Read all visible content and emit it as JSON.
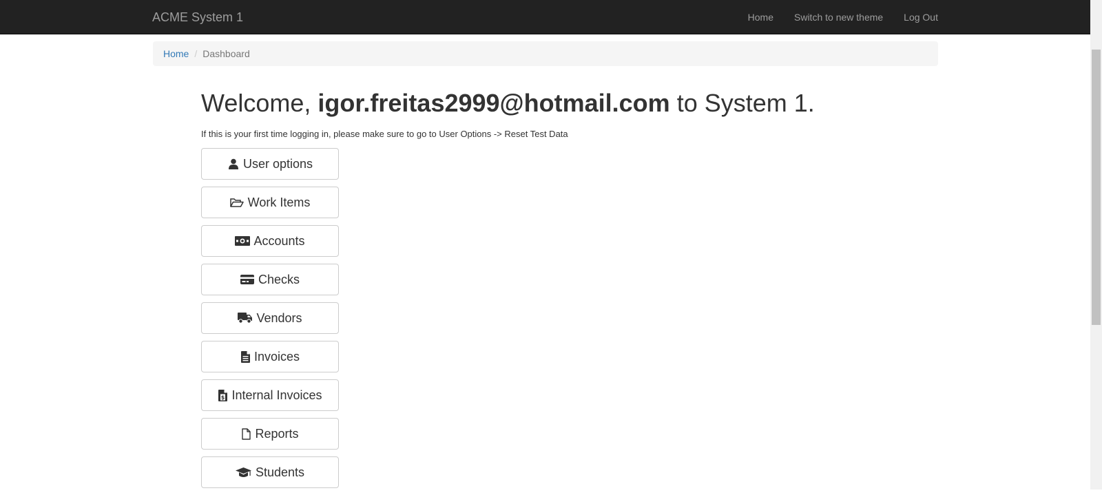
{
  "navbar": {
    "brand": "ACME System 1",
    "links": [
      "Home",
      "Switch to new theme",
      "Log Out"
    ]
  },
  "breadcrumb": {
    "home": "Home",
    "separator": "/",
    "current": "Dashboard"
  },
  "welcome": {
    "prefix": "Welcome,",
    "user": "igor.freitas2999@hotmail.com",
    "suffix": "to System 1."
  },
  "note": "If this is your first time logging in, please make sure to go to User Options -> Reset Test Data",
  "menu": [
    {
      "label": "User options",
      "icon": "user-icon"
    },
    {
      "label": "Work Items",
      "icon": "folder-open-icon"
    },
    {
      "label": "Accounts",
      "icon": "money-icon"
    },
    {
      "label": "Checks",
      "icon": "credit-card-icon"
    },
    {
      "label": "Vendors",
      "icon": "truck-icon"
    },
    {
      "label": "Invoices",
      "icon": "file-text-icon"
    },
    {
      "label": "Internal Invoices",
      "icon": "file-dollar-icon"
    },
    {
      "label": "Reports",
      "icon": "file-icon"
    },
    {
      "label": "Students",
      "icon": "graduation-cap-icon"
    }
  ],
  "colors": {
    "navbar_bg": "#222222",
    "navbar_text": "#9d9d9d",
    "link": "#337ab7",
    "breadcrumb_bg": "#f5f5f5"
  }
}
